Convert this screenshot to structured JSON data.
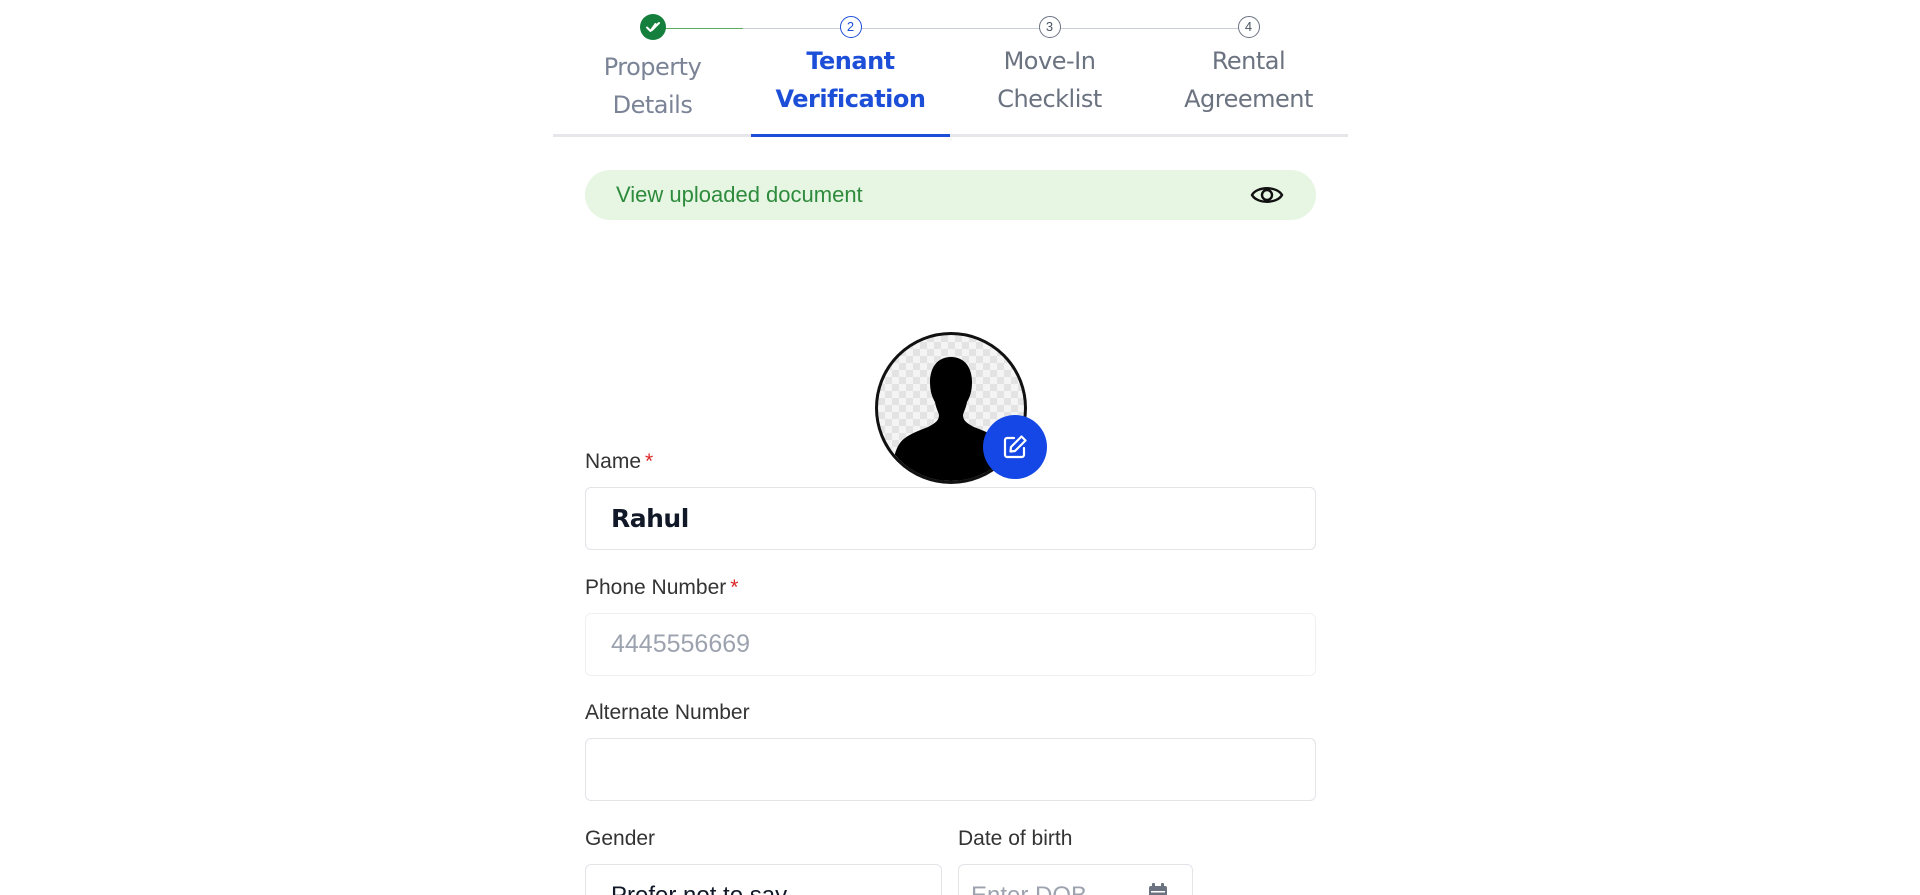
{
  "stepper": {
    "steps": [
      {
        "number": "✓",
        "label_line1": "Property",
        "label_line2": "Details",
        "state": "done"
      },
      {
        "number": "2",
        "label_line1": "Tenant",
        "label_line2": "Verification",
        "state": "active"
      },
      {
        "number": "3",
        "label_line1": "Move-In",
        "label_line2": "Checklist",
        "state": "pending"
      },
      {
        "number": "4",
        "label_line1": "Rental",
        "label_line2": "Agreement",
        "state": "pending"
      }
    ]
  },
  "document_banner": {
    "text": "View uploaded document",
    "icon": "eye-icon"
  },
  "avatar": {
    "icon": "person-silhouette-icon",
    "edit_icon": "edit-icon"
  },
  "form": {
    "name": {
      "label": "Name",
      "required_mark": "*",
      "value": "Rahul"
    },
    "phone": {
      "label": "Phone Number",
      "required_mark": "*",
      "value": "4445556669"
    },
    "alternate": {
      "label": "Alternate Number",
      "value": ""
    },
    "gender": {
      "label": "Gender",
      "value": "Prefer not to say"
    },
    "dob": {
      "label": "Date of birth",
      "placeholder": "Enter DOB",
      "icon": "calendar-icon"
    }
  },
  "colors": {
    "primary": "#1d4ed8",
    "success": "#15803d",
    "banner_bg": "#e6f6e2",
    "required": "#dc2626"
  }
}
